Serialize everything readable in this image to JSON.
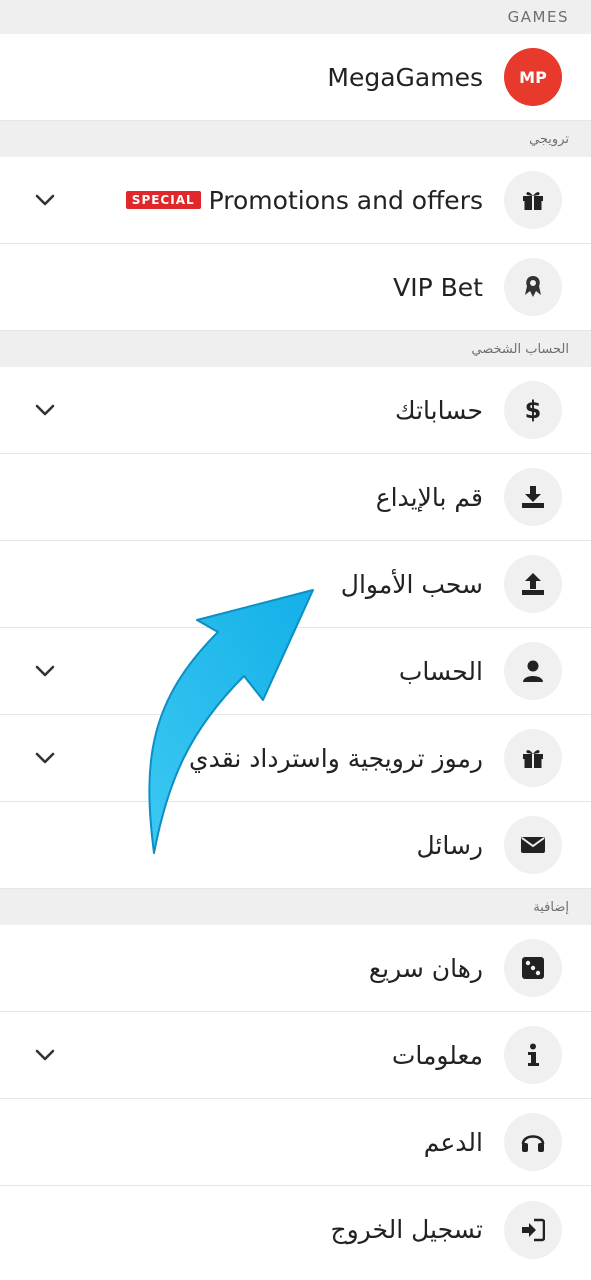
{
  "games_section": {
    "title": "GAMES"
  },
  "brand": {
    "name": "MegaGames",
    "badge": "MP"
  },
  "promo_section": {
    "title": "ترويجي"
  },
  "promotions": {
    "label": "Promotions and offers",
    "badge": "SPECIAL"
  },
  "vip": {
    "label": "VIP Bet"
  },
  "personal_section": {
    "title": "الحساب الشخصي"
  },
  "personal_items": [
    {
      "label": "حساباتك",
      "icon": "dollar-icon",
      "expandable": true
    },
    {
      "label": "قم بالإيداع",
      "icon": "download-icon",
      "expandable": false
    },
    {
      "label": "سحب الأموال",
      "icon": "upload-icon",
      "expandable": false
    },
    {
      "label": "الحساب",
      "icon": "user-icon",
      "expandable": true
    },
    {
      "label": "رموز ترويجية واسترداد نقدي",
      "icon": "gift-icon",
      "expandable": true
    },
    {
      "label": "رسائل",
      "icon": "envelope-icon",
      "expandable": false
    }
  ],
  "extra_section": {
    "title": "إضافية"
  },
  "extra_items": [
    {
      "label": "رهان سريع",
      "icon": "dice-icon",
      "expandable": false
    },
    {
      "label": "معلومات",
      "icon": "info-icon",
      "expandable": true
    },
    {
      "label": "الدعم",
      "icon": "headset-icon",
      "expandable": false
    },
    {
      "label": "تسجيل الخروج",
      "icon": "logout-icon",
      "expandable": false
    }
  ],
  "colors": {
    "brand_red": "#e8392d",
    "arrow_blue": "#1bb6ea",
    "section_bg": "#efefef"
  }
}
